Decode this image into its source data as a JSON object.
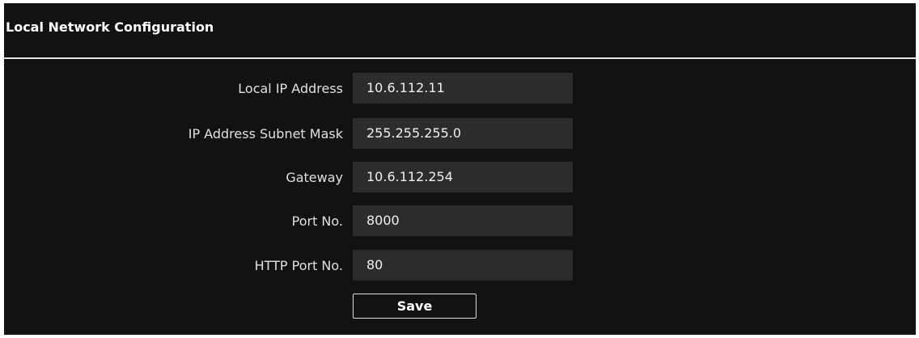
{
  "section": {
    "title": "Local Network Configuration"
  },
  "fields": [
    {
      "label": "Local IP Address",
      "value": "10.6.112.11"
    },
    {
      "label": "IP Address Subnet Mask",
      "value": "255.255.255.0"
    },
    {
      "label": "Gateway",
      "value": "10.6.112.254"
    },
    {
      "label": "Port No.",
      "value": "8000"
    },
    {
      "label": "HTTP Port No.",
      "value": "80"
    }
  ],
  "actions": {
    "save_label": "Save"
  },
  "colors": {
    "panel_background": "#121212",
    "input_background": "#2c2c2c",
    "divider": "#e6e6e6",
    "text": "#ffffff"
  }
}
